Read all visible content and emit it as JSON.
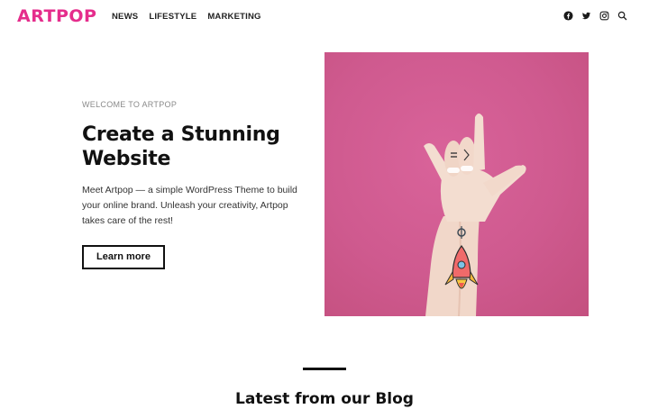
{
  "header": {
    "logo_text": "ARTPOP",
    "nav": [
      {
        "label": "NEWS"
      },
      {
        "label": "LIFESTYLE"
      },
      {
        "label": "MARKETING"
      }
    ],
    "icons": [
      "facebook-icon",
      "twitter-icon",
      "instagram-icon",
      "search-icon"
    ]
  },
  "hero": {
    "eyebrow": "WELCOME TO ARTPOP",
    "title": "Create a Stunning Website",
    "description": "Meet Artpop — a simple WordPress Theme to build your online brand.  Unleash your creativity, Artpop takes care of the rest!",
    "cta_label": "Learn more"
  },
  "blog": {
    "heading": "Latest from our Blog"
  },
  "colors": {
    "brand": "#e52d8c",
    "image_bg": "#cf5a8f",
    "text": "#111111"
  }
}
